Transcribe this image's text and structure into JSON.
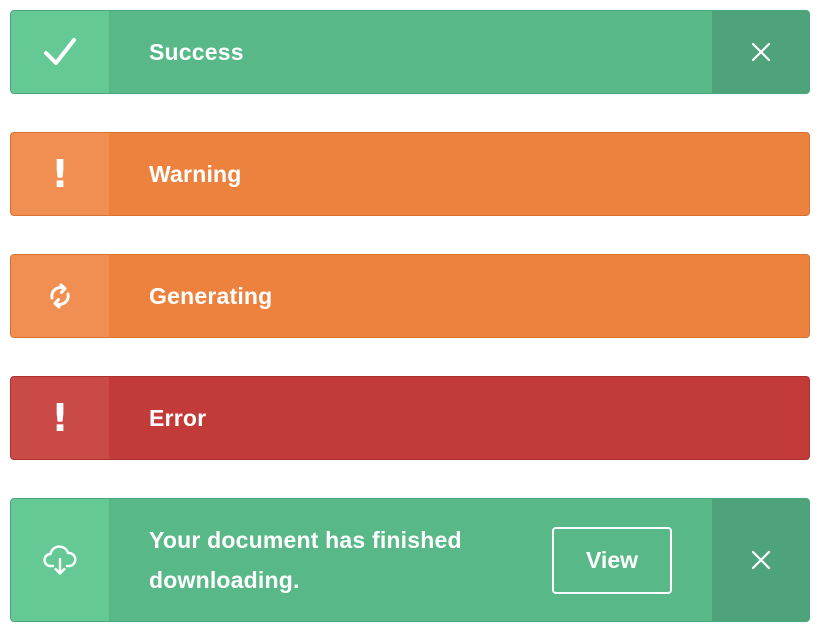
{
  "colors": {
    "success": "#58b888",
    "warning": "#ed823e",
    "error": "#c23b38",
    "text": "#ffffff"
  },
  "alerts": [
    {
      "type": "success",
      "icon": "check-icon",
      "message": "Success",
      "closable": true
    },
    {
      "type": "warning",
      "icon": "exclamation-icon",
      "message": "Warning",
      "icon_text": "!"
    },
    {
      "type": "warning",
      "icon": "refresh-icon",
      "message": "Generating"
    },
    {
      "type": "error",
      "icon": "exclamation-icon",
      "message": "Error",
      "icon_text": "!"
    },
    {
      "type": "success",
      "icon": "cloud-download-icon",
      "message": "Your document has finished downloading.",
      "action_label": "View",
      "closable": true
    }
  ]
}
